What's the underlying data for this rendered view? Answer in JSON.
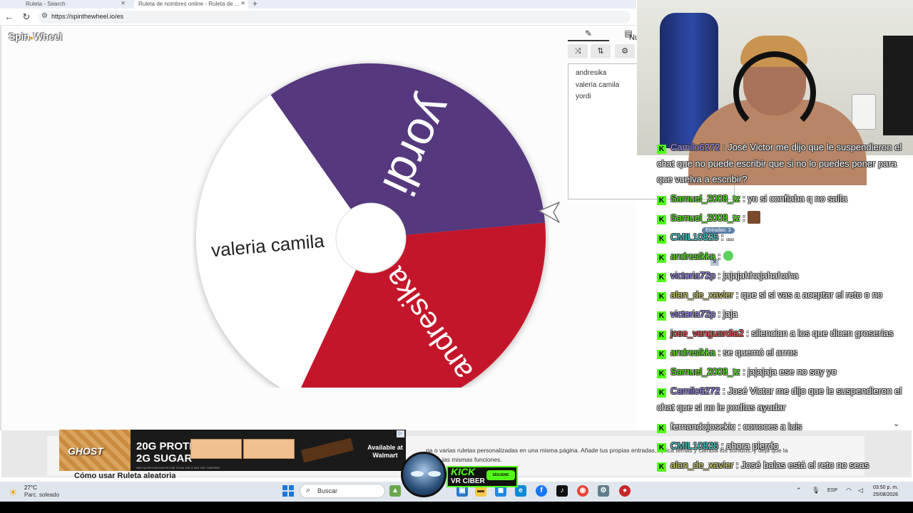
{
  "browser": {
    "tabs": [
      {
        "label": "Ruleta - Search"
      },
      {
        "label": "Ruleta de nombres online - Ruleta de ..."
      }
    ],
    "url": "https://spinthewheel.io/es"
  },
  "page": {
    "logo": "Spin Wheel",
    "nav_partial": "Nu",
    "entries_badge": "Entradas: 3"
  },
  "wheel": {
    "colors": [
      "#54377e",
      "#ffffff",
      "#c4162a"
    ],
    "segments": [
      {
        "label": "yordi",
        "color": "#54377e",
        "text_color": "#ffffff"
      },
      {
        "label": "valeria camila",
        "color": "#ffffff",
        "text_color": "#222222"
      },
      {
        "label": "andresika",
        "color": "#c4162a",
        "text_color": "#ffffff"
      }
    ]
  },
  "panel": {
    "tabs": [
      {
        "icon": "pencil-icon",
        "glyph": "✎"
      },
      {
        "icon": "clipboard-icon",
        "glyph": "▤"
      }
    ],
    "tools": [
      {
        "icon": "shuffle-icon",
        "glyph": "⤨"
      },
      {
        "icon": "sort-icon",
        "glyph": "⇅"
      },
      {
        "icon": "settings-icon",
        "glyph": "⚙"
      }
    ],
    "entries": [
      "andresika",
      "valeria camila",
      "yordi"
    ]
  },
  "below": {
    "description": "...na o varias ruletas personalizadas en una misma página. Añade tus propias entradas, aplica temas y cambia los sonidos, y deja que la",
    "description2": "las mismas funciones.",
    "howto": "Cómo usar Ruleta aleatoria"
  },
  "ad": {
    "brand": "GHOST",
    "line1": "20G PROTEIN",
    "line2": "2G SUGAR",
    "fineprint": "SEE NUTRITION FACTS FOR TOTAL FAT & SAT. FAT CONTENT",
    "retailer": "Available at Walmart"
  },
  "stream": {
    "kick_title": "KICK",
    "kick_sub": "VR CIBER",
    "kick_follow": "SÍGUEME",
    "chat": [
      {
        "user": "Camilo6272",
        "color": "#9b8cff",
        "text": "José Victor me dijo que le suspendieron el chat que no puede escribir que si no lo puedes poner para que vuelva a escribir?"
      },
      {
        "user": "Samuel_2008_tz",
        "color": "#53fc18",
        "text": "yo si confiaba q no salía"
      },
      {
        "user": "Samuel_2008_tz",
        "color": "#53fc18",
        "text": "",
        "emote": "emote"
      },
      {
        "user": "CMIL10826",
        "color": "#3ed8d8",
        "text": "..."
      },
      {
        "user": "andresikka",
        "color": "#53fc18",
        "text": "",
        "emote": "emote2"
      },
      {
        "user": "victoria72p",
        "color": "#9b8cff",
        "text": "jajajahhajahahaha"
      },
      {
        "user": "alan_de_xavier",
        "color": "#d7d96b",
        "text": "que si si vas a aceptar el reto o no"
      },
      {
        "user": "victoria72p",
        "color": "#9b8cff",
        "text": "jaja"
      },
      {
        "user": "jose_vanguardia2",
        "color": "#ff4b4b",
        "text": "silencian a los que dicen groserias"
      },
      {
        "user": "andresikka",
        "color": "#53fc18",
        "text": "se quemó el arros"
      },
      {
        "user": "Samuel_2008_tz",
        "color": "#53fc18",
        "text": "jajajaja ese no soy yo"
      },
      {
        "user": "Camilo6272",
        "color": "#9b8cff",
        "text": "José Victor me dijo que le suspendieron el chat que si no le podías ayudar"
      },
      {
        "user": "fernandojosekic",
        "color": "#ffffff",
        "text": "conoces a luis"
      },
      {
        "user": "CMIL10826",
        "color": "#3ed8d8",
        "text": "ahora pierdo"
      },
      {
        "user": "alan_de_xavier",
        "color": "#d7d96b",
        "text": "José balas está el reto no seas"
      }
    ]
  },
  "taskbar": {
    "weather_temp": "27°C",
    "weather_desc": "Parc. soleado",
    "search_placeholder": "Buscar",
    "language": "ESP",
    "time": "03:50 p. m.",
    "date": "25/08/2026"
  }
}
